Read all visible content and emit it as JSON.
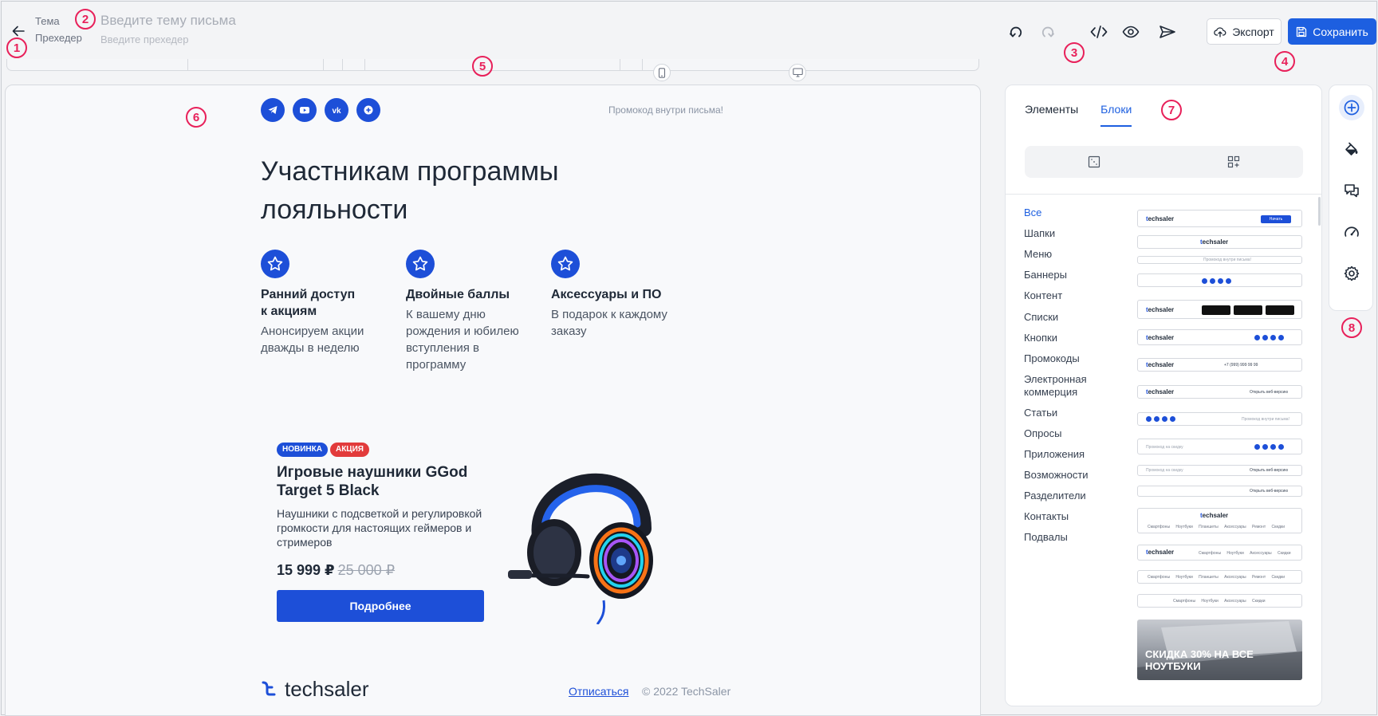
{
  "header": {
    "subject_label": "Тема",
    "subject_placeholder": "Введите тему письма",
    "preheader_label": "Прехедер",
    "preheader_placeholder": "Введите прехедер",
    "export_label": "Экспорт",
    "save_label": "Сохранить",
    "accent_color": "#1d5fe0"
  },
  "annotations": [
    "1",
    "2",
    "3",
    "4",
    "5",
    "6",
    "7",
    "8"
  ],
  "email": {
    "promo_note": "Промокод внутри письма!",
    "socials": [
      "telegram-icon",
      "youtube-icon",
      "vk-icon",
      "plus-icon"
    ],
    "hero_title": "Участникам программы лояльности",
    "features": [
      {
        "title": "Ранний доступ к акциям",
        "text": "Анонсируем акции дважды в неделю"
      },
      {
        "title": "Двойные баллы",
        "text": "К вашему дню рождения и юбилею вступления в программу"
      },
      {
        "title": "Аксессуары и ПО",
        "text": "В подарок к каждому заказу"
      }
    ],
    "product": {
      "tag_new": "НОВИНКА",
      "tag_sale": "АКЦИЯ",
      "title": "Игровые наушники GGod Target 5 Black",
      "description": "Наушники с подсветкой и регулировкой громкости для настоящих геймеров и стримеров",
      "price": "15 999 ₽",
      "old_price": "25 000 ₽",
      "button": "Подробнее"
    },
    "footer": {
      "logo": "techsaler",
      "unsubscribe": "Отписаться",
      "copyright": "© 2022 TechSaler"
    }
  },
  "panel": {
    "tabs": [
      "Элементы",
      "Блоки"
    ],
    "active_tab": "Блоки",
    "categories": [
      "Все",
      "Шапки",
      "Меню",
      "Баннеры",
      "Контент",
      "Списки",
      "Кнопки",
      "Промокоды",
      "Электронная коммерция",
      "Статьи",
      "Опросы",
      "Приложения",
      "Возможности",
      "Разделители",
      "Контакты",
      "Подвалы"
    ],
    "active_category": "Все",
    "thumb_logo": "techsaler",
    "thumb_button": "Начать",
    "thumb_phone": "+7 (999) 999 99 99",
    "thumb_promo": "Промокод внутри письма!",
    "thumb_promocode": "Промокод на скидку",
    "thumb_all": "Открыть веб-версию",
    "thumb_nav": "Смартфоны Ноутбуки Планшеты Аксессуары Ремонт Скидки",
    "thumb_nav_short": "Смартфоны Ноутбуки Аксессуары Скидки",
    "sale_banner": "СКИДКА 30% НА ВСЕ НОУТБУКИ"
  },
  "rail": [
    "add-block-icon",
    "paint-bucket-icon",
    "comments-icon",
    "speedometer-icon",
    "settings-icon"
  ]
}
